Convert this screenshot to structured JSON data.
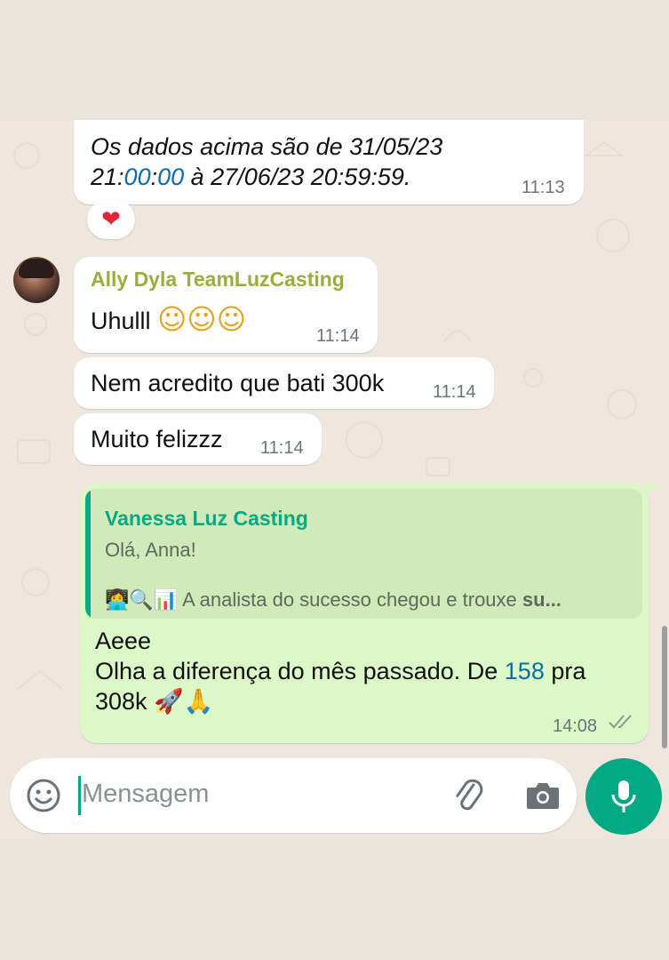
{
  "messages": [
    {
      "id": "m1",
      "line1": "Os dados acima são de 31/05/23",
      "line2_a": "21:",
      "line2_b": "00",
      "line2_c": ":",
      "line2_d": "00",
      "line2_e": " à 27/06/23 20:59:59.",
      "time": "11:13",
      "reaction": "❤"
    },
    {
      "id": "m2",
      "sender": "Ally Dyla TeamLuzCasting",
      "text": "Uhulll",
      "emojis": "☺☺☺",
      "time": "11:14"
    },
    {
      "id": "m3",
      "text": "Nem acredito que bati 300k",
      "time": "11:14"
    },
    {
      "id": "m4",
      "text": "Muito felizzz",
      "time": "11:14"
    }
  ],
  "reply": {
    "quoted_sender": "Vanessa Luz Casting",
    "quoted_line1": "Olá, Anna!",
    "quoted_emojis": "👩‍💻🔍📊",
    "quoted_line2": " A analista do sucesso chegou e trouxe ",
    "quoted_line2_bold": "su...",
    "line1": "Aeee",
    "line2_a": "Olha a diferença do mês passado. De ",
    "line2_number": "158",
    "line2_b": " pra",
    "line3": "308k ",
    "line3_emojis": "🚀🙏",
    "time": "14:08"
  },
  "composer": {
    "placeholder": "Mensagem"
  },
  "icons": {
    "emoji": "emoji-icon",
    "attach": "paperclip-icon",
    "camera": "camera-icon",
    "mic": "microphone-icon",
    "read": "double-check-icon"
  },
  "colors": {
    "accent": "#00a884",
    "sender_name": "#9aae3b",
    "outgoing_bubble": "#dcf8c6",
    "link_number": "#0b6eaa"
  }
}
